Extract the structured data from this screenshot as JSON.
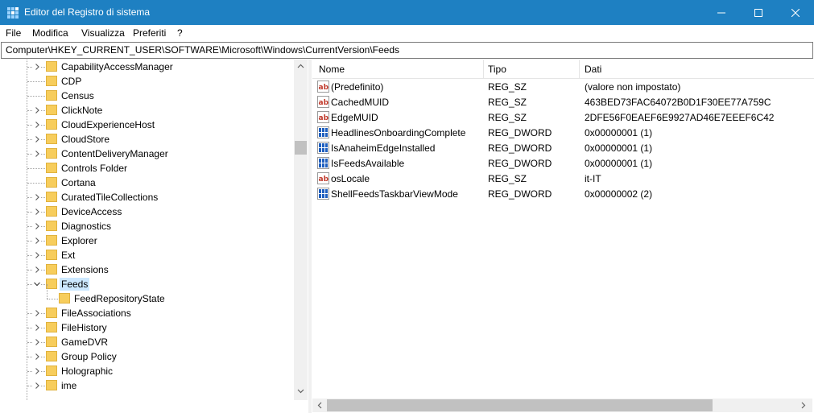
{
  "window": {
    "title": "Editor del Registro di sistema",
    "accent": "#1e80c2"
  },
  "menu": {
    "file": "File",
    "edit": "Modifica",
    "view": "Visualizza",
    "favorites": "Preferiti",
    "help": "?"
  },
  "address": "Computer\\HKEY_CURRENT_USER\\SOFTWARE\\Microsoft\\Windows\\CurrentVersion\\Feeds",
  "tree": {
    "items": [
      {
        "label": "CapabilityAccessManager",
        "expandable": true
      },
      {
        "label": "CDP",
        "expandable": false
      },
      {
        "label": "Census",
        "expandable": false
      },
      {
        "label": "ClickNote",
        "expandable": true
      },
      {
        "label": "CloudExperienceHost",
        "expandable": true
      },
      {
        "label": "CloudStore",
        "expandable": true
      },
      {
        "label": "ContentDeliveryManager",
        "expandable": true
      },
      {
        "label": "Controls Folder",
        "expandable": false
      },
      {
        "label": "Cortana",
        "expandable": false
      },
      {
        "label": "CuratedTileCollections",
        "expandable": true
      },
      {
        "label": "DeviceAccess",
        "expandable": true
      },
      {
        "label": "Diagnostics",
        "expandable": true
      },
      {
        "label": "Explorer",
        "expandable": true
      },
      {
        "label": "Ext",
        "expandable": true
      },
      {
        "label": "Extensions",
        "expandable": true
      },
      {
        "label": "Feeds",
        "expandable": true,
        "expanded": true,
        "selected": true
      },
      {
        "label": "FeedRepositoryState",
        "expandable": false,
        "child": true
      },
      {
        "label": "FileAssociations",
        "expandable": true
      },
      {
        "label": "FileHistory",
        "expandable": true
      },
      {
        "label": "GameDVR",
        "expandable": true
      },
      {
        "label": "Group Policy",
        "expandable": true
      },
      {
        "label": "Holographic",
        "expandable": true
      },
      {
        "label": "ime",
        "expandable": true
      }
    ]
  },
  "values": {
    "columns": {
      "name": "Nome",
      "type": "Tipo",
      "data": "Dati"
    },
    "rows": [
      {
        "icon": "string-value-icon",
        "name": "(Predefinito)",
        "type": "REG_SZ",
        "data": "(valore non impostato)"
      },
      {
        "icon": "string-value-icon",
        "name": "CachedMUID",
        "type": "REG_SZ",
        "data": "463BED73FAC64072B0D1F30EE77A759C"
      },
      {
        "icon": "string-value-icon",
        "name": "EdgeMUID",
        "type": "REG_SZ",
        "data": "2DFE56F0EAEF6E9927AD46E7EEEF6C42"
      },
      {
        "icon": "binary-value-icon",
        "name": "HeadlinesOnboardingComplete",
        "type": "REG_DWORD",
        "data": "0x00000001 (1)"
      },
      {
        "icon": "binary-value-icon",
        "name": "IsAnaheimEdgeInstalled",
        "type": "REG_DWORD",
        "data": "0x00000001 (1)"
      },
      {
        "icon": "binary-value-icon",
        "name": "IsFeedsAvailable",
        "type": "REG_DWORD",
        "data": "0x00000001 (1)"
      },
      {
        "icon": "string-value-icon",
        "name": "osLocale",
        "type": "REG_SZ",
        "data": "it-IT"
      },
      {
        "icon": "binary-value-icon",
        "name": "ShellFeedsTaskbarViewMode",
        "type": "REG_DWORD",
        "data": "0x00000002 (2)"
      }
    ]
  }
}
